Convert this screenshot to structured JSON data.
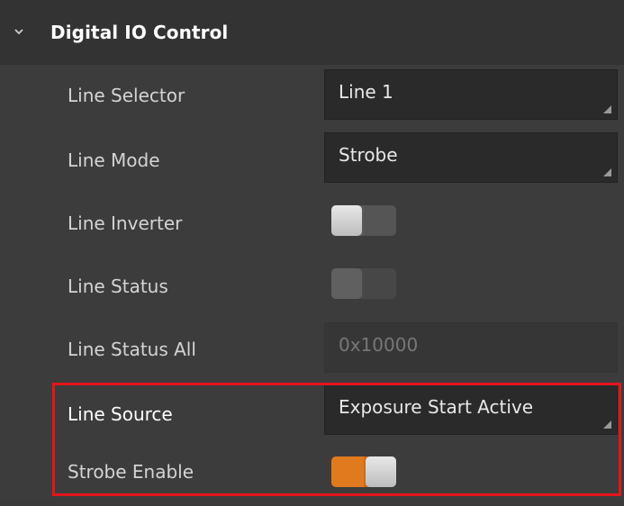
{
  "section": {
    "title": "Digital IO Control",
    "icon": "chevron-down-icon",
    "expanded": true
  },
  "rows": {
    "line_selector": {
      "label": "Line Selector",
      "value": "Line 1"
    },
    "line_mode": {
      "label": "Line Mode",
      "value": "Strobe"
    },
    "line_inverter": {
      "label": "Line Inverter",
      "on": false
    },
    "line_status": {
      "label": "Line Status",
      "on": false,
      "enabled": false
    },
    "line_status_all": {
      "label": "Line Status All",
      "value": "0x10000",
      "enabled": false
    },
    "line_source": {
      "label": "Line Source",
      "value": "Exposure Start Active"
    },
    "strobe_enable": {
      "label": "Strobe Enable",
      "on": true
    }
  },
  "colors": {
    "toggle_on": "#e07a1f",
    "highlight_border": "#e5151b"
  }
}
